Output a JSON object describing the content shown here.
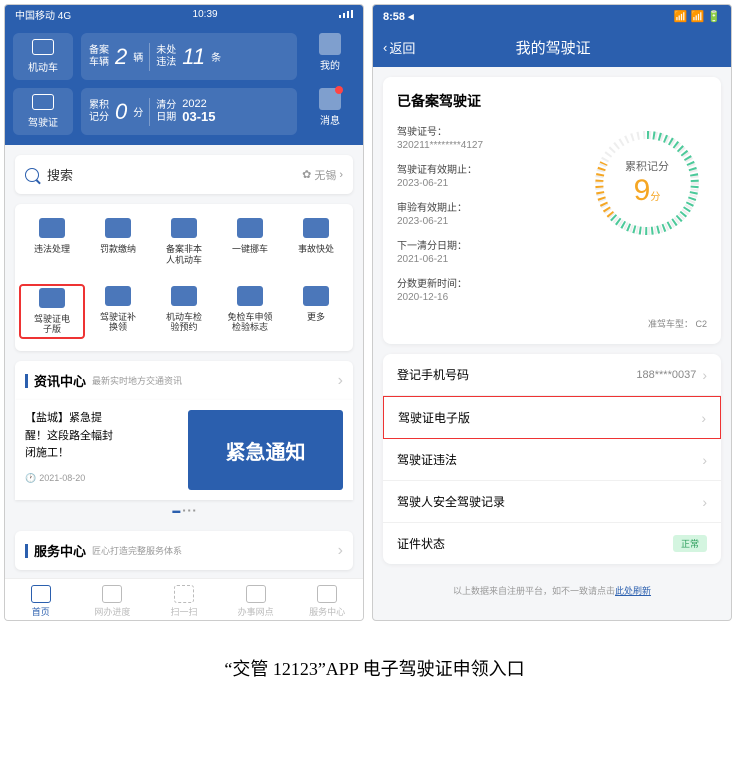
{
  "left": {
    "status": {
      "carrier": "中国移动  4G",
      "time": "10:39"
    },
    "side": {
      "car": "机动车",
      "license": "驾驶证"
    },
    "right_side": {
      "profile": "我的",
      "message": "消息"
    },
    "stat1": {
      "l1": "备案\n车辆",
      "v1": "2",
      "u1": "辆",
      "l2": "未处\n违法",
      "v2": "11",
      "u2": "条"
    },
    "stat2": {
      "l1": "累积\n记分",
      "v1": "0",
      "u1": "分",
      "l2": "清分\n日期",
      "v2": "2022",
      "v3": "03-15"
    },
    "search": {
      "placeholder": "搜索",
      "location": "无锡"
    },
    "grid": [
      {
        "label": "违法处理"
      },
      {
        "label": "罚款缴纳"
      },
      {
        "label": "备案非本\n人机动车"
      },
      {
        "label": "一键挪车"
      },
      {
        "label": "事故快处"
      },
      {
        "label": "驾驶证电\n子版",
        "hl": true
      },
      {
        "label": "驾驶证补\n换领"
      },
      {
        "label": "机动车检\n验预约"
      },
      {
        "label": "免检车申领\n检验标志"
      },
      {
        "label": "更多"
      }
    ],
    "news_hdr": {
      "title": "资讯中心",
      "sub": "最新实时地方交通资讯"
    },
    "news": {
      "text": "【盐城】紧急提\n醒！这段路全幅封\n闭施工！",
      "date": "2021-08-20",
      "banner": "紧急通知"
    },
    "svc_hdr": {
      "title": "服务中心",
      "sub": "匠心打造完整服务体系"
    },
    "tabs": [
      {
        "label": "首页",
        "active": true
      },
      {
        "label": "网办进度"
      },
      {
        "label": "扫一扫",
        "scan": true
      },
      {
        "label": "办事网点"
      },
      {
        "label": "服务中心"
      }
    ]
  },
  "right": {
    "status": {
      "time": "8:58"
    },
    "nav": {
      "back": "返回",
      "title": "我的驾驶证"
    },
    "card_title": "已备案驾驶证",
    "info": [
      {
        "l": "驾驶证号：",
        "v": "320211********4127"
      },
      {
        "l": "驾驶证有效期止：",
        "v": "2023-06-21"
      },
      {
        "l": "审验有效期止：",
        "v": "2023-06-21"
      },
      {
        "l": "下一清分日期：",
        "v": "2021-06-21"
      },
      {
        "l": "分数更新时间：",
        "v": "2020-12-16"
      }
    ],
    "gauge": {
      "label": "累积记分",
      "value": "9",
      "unit": "分"
    },
    "car_type": {
      "l": "准驾车型：",
      "v": "C2"
    },
    "list": [
      {
        "l": "登记手机号码",
        "v": "188****0037"
      },
      {
        "l": "驾驶证电子版",
        "hl": true
      },
      {
        "l": "驾驶证违法"
      },
      {
        "l": "驾驶人安全驾驶记录"
      },
      {
        "l": "证件状态",
        "badge": "正常"
      }
    ],
    "footer": {
      "text": "以上数据来自注册平台，如不一致请点击",
      "link": "此处刷新"
    }
  },
  "caption": "“交管 12123”APP 电子驾驶证申领入口"
}
